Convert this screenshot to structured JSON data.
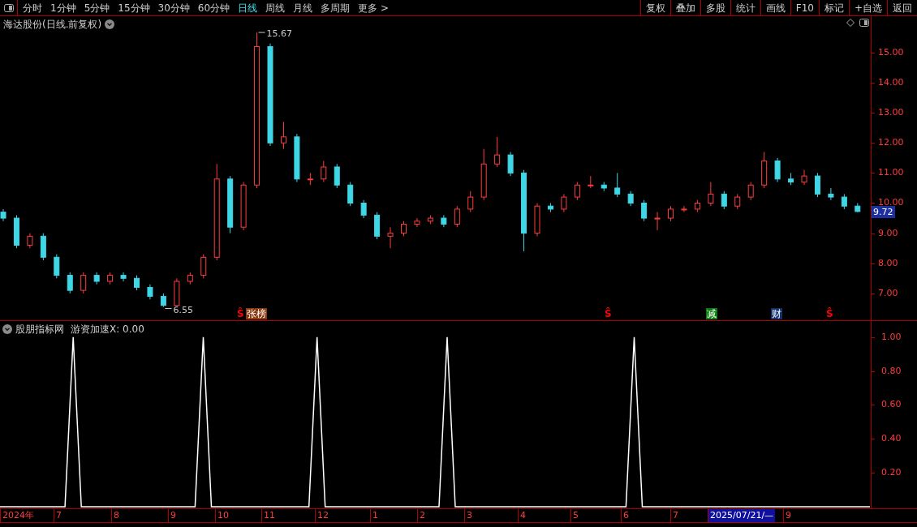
{
  "toolbar": {
    "periods": [
      {
        "label": "分时",
        "selected": false
      },
      {
        "label": "1分钟",
        "selected": false
      },
      {
        "label": "5分钟",
        "selected": false
      },
      {
        "label": "15分钟",
        "selected": false
      },
      {
        "label": "30分钟",
        "selected": false
      },
      {
        "label": "60分钟",
        "selected": false
      },
      {
        "label": "日线",
        "selected": true
      },
      {
        "label": "周线",
        "selected": false
      },
      {
        "label": "月线",
        "selected": false
      },
      {
        "label": "多周期",
        "selected": false
      },
      {
        "label": "更多 >",
        "selected": false
      }
    ],
    "actions": [
      "复权",
      "叠加",
      "多股",
      "统计",
      "画线",
      "F10",
      "标记",
      "+自选",
      "返回"
    ]
  },
  "main_chart": {
    "title": "海达股份(日线.前复权)",
    "current_price": "9.72",
    "high_label": "15.67",
    "low_label": "6.55",
    "chart_data": {
      "type": "candlestick",
      "ylim": [
        6.08,
        16.21
      ],
      "yticks": [
        {
          "value": 7,
          "label": "7.00"
        },
        {
          "value": 8,
          "label": "8.00"
        },
        {
          "value": 9,
          "label": "9.00"
        },
        {
          "value": 10,
          "label": "10.00"
        },
        {
          "value": 11,
          "label": "11.00"
        },
        {
          "value": 12,
          "label": "12.00"
        },
        {
          "value": 13,
          "label": "13.00"
        },
        {
          "value": 14,
          "label": "14.00"
        },
        {
          "value": 15,
          "label": "15.00"
        }
      ],
      "ohlc": [
        [
          9.7,
          9.8,
          9.4,
          9.5
        ],
        [
          9.5,
          9.6,
          8.5,
          8.6
        ],
        [
          8.6,
          9.0,
          8.5,
          8.9
        ],
        [
          8.9,
          9.0,
          8.1,
          8.2
        ],
        [
          8.2,
          8.3,
          7.5,
          7.6
        ],
        [
          7.6,
          7.7,
          7.0,
          7.1
        ],
        [
          7.1,
          7.7,
          7.0,
          7.6
        ],
        [
          7.6,
          7.7,
          7.3,
          7.4
        ],
        [
          7.4,
          7.7,
          7.3,
          7.6
        ],
        [
          7.6,
          7.7,
          7.4,
          7.5
        ],
        [
          7.5,
          7.6,
          7.1,
          7.2
        ],
        [
          7.2,
          7.3,
          6.8,
          6.9
        ],
        [
          6.9,
          7.0,
          6.55,
          6.6
        ],
        [
          6.6,
          7.5,
          6.6,
          7.4
        ],
        [
          7.4,
          7.7,
          7.3,
          7.6
        ],
        [
          7.6,
          8.3,
          7.5,
          8.2
        ],
        [
          8.2,
          11.3,
          8.1,
          10.8
        ],
        [
          10.8,
          10.9,
          9.0,
          9.2
        ],
        [
          9.2,
          10.7,
          9.1,
          10.6
        ],
        [
          10.6,
          15.67,
          10.5,
          15.2
        ],
        [
          15.2,
          15.3,
          11.9,
          12.0
        ],
        [
          12.0,
          12.7,
          11.8,
          12.2
        ],
        [
          12.2,
          12.3,
          10.7,
          10.8
        ],
        [
          10.8,
          11.0,
          10.6,
          10.8
        ],
        [
          10.8,
          11.4,
          10.7,
          11.2
        ],
        [
          11.2,
          11.3,
          10.5,
          10.6
        ],
        [
          10.6,
          10.7,
          9.9,
          10.0
        ],
        [
          10.0,
          10.1,
          9.5,
          9.6
        ],
        [
          9.6,
          9.7,
          8.8,
          8.9
        ],
        [
          8.9,
          9.2,
          8.5,
          9.0
        ],
        [
          9.0,
          9.4,
          8.9,
          9.3
        ],
        [
          9.3,
          9.5,
          9.2,
          9.4
        ],
        [
          9.4,
          9.6,
          9.3,
          9.5
        ],
        [
          9.5,
          9.6,
          9.2,
          9.3
        ],
        [
          9.3,
          9.9,
          9.2,
          9.8
        ],
        [
          9.8,
          10.4,
          9.7,
          10.2
        ],
        [
          10.2,
          11.8,
          10.1,
          11.3
        ],
        [
          11.3,
          12.2,
          11.2,
          11.6
        ],
        [
          11.6,
          11.7,
          10.9,
          11.0
        ],
        [
          11.0,
          11.1,
          8.4,
          9.0
        ],
        [
          9.0,
          10.0,
          8.9,
          9.9
        ],
        [
          9.9,
          10.0,
          9.7,
          9.8
        ],
        [
          9.8,
          10.3,
          9.7,
          10.2
        ],
        [
          10.2,
          10.7,
          10.1,
          10.6
        ],
        [
          10.6,
          10.9,
          10.5,
          10.6
        ],
        [
          10.6,
          10.7,
          10.4,
          10.5
        ],
        [
          10.5,
          11.0,
          10.2,
          10.3
        ],
        [
          10.3,
          10.4,
          9.9,
          10.0
        ],
        [
          10.0,
          10.1,
          9.4,
          9.5
        ],
        [
          9.5,
          9.7,
          9.1,
          9.5
        ],
        [
          9.5,
          9.9,
          9.4,
          9.8
        ],
        [
          9.8,
          9.9,
          9.7,
          9.8
        ],
        [
          9.8,
          10.1,
          9.7,
          10.0
        ],
        [
          10.0,
          10.7,
          9.9,
          10.3
        ],
        [
          10.3,
          10.4,
          9.8,
          9.9
        ],
        [
          9.9,
          10.3,
          9.8,
          10.2
        ],
        [
          10.2,
          10.7,
          10.1,
          10.6
        ],
        [
          10.6,
          11.7,
          10.5,
          11.4
        ],
        [
          11.4,
          11.5,
          10.7,
          10.8
        ],
        [
          10.8,
          11.0,
          10.6,
          10.7
        ],
        [
          10.7,
          11.1,
          10.6,
          10.9
        ],
        [
          10.9,
          11.0,
          10.2,
          10.3
        ],
        [
          10.3,
          10.5,
          10.1,
          10.2
        ],
        [
          10.2,
          10.3,
          9.8,
          9.9
        ],
        [
          9.9,
          10.0,
          9.7,
          9.72
        ]
      ]
    },
    "markers": [
      {
        "kind": "symbol",
        "text": "Ŝ",
        "color": "#ff0000"
      },
      {
        "kind": "tag",
        "text": "张榜",
        "color": "#8b3a10"
      },
      {
        "kind": "symbol",
        "text": "Ŝ",
        "color": "#ff0000"
      },
      {
        "kind": "tag",
        "text": "减",
        "color": "#0a7a0a"
      },
      {
        "kind": "tag",
        "text": "财",
        "color": "#12306e"
      },
      {
        "kind": "symbol",
        "text": "Ŝ",
        "color": "#ff0000"
      }
    ]
  },
  "indicator": {
    "source": "股朋指标网",
    "reading": "游资加速X: 0.00",
    "chart_data": {
      "type": "line",
      "ylim": [
        -0.01,
        1.095
      ],
      "yticks": [
        {
          "value": 0.2,
          "label": "0.20"
        },
        {
          "value": 0.4,
          "label": "0.40"
        },
        {
          "value": 0.6,
          "label": "0.60"
        },
        {
          "value": 0.8,
          "label": "0.80"
        },
        {
          "value": 1,
          "label": "1.00"
        }
      ],
      "series": [
        {
          "color": "#ffffff",
          "values": [
            0,
            0,
            0,
            0,
            0,
            0,
            0,
            0,
            0,
            1,
            0,
            0,
            0,
            0,
            0,
            0,
            0,
            0,
            0,
            0,
            0,
            0,
            0,
            0,
            0,
            1,
            0,
            0,
            0,
            0,
            0,
            0,
            0,
            0,
            0,
            0,
            0,
            0,
            0,
            1,
            0,
            0,
            0,
            0,
            0,
            0,
            0,
            0,
            0,
            0,
            0,
            0,
            0,
            0,
            0,
            1,
            0,
            0,
            0,
            0,
            0,
            0,
            0,
            0,
            0,
            0,
            0,
            0,
            0,
            0,
            0,
            0,
            0,
            0,
            0,
            0,
            0,
            0,
            1,
            0,
            0,
            0,
            0,
            0,
            0,
            0,
            0,
            0,
            0,
            0,
            0,
            0,
            0,
            0,
            0,
            0,
            0,
            0,
            0,
            0,
            0,
            0,
            0,
            0,
            0,
            0,
            0,
            0
          ]
        }
      ]
    }
  },
  "date_axis": [
    {
      "label": "2024年",
      "selected": false
    },
    {
      "label": "7",
      "selected": false
    },
    {
      "label": "8",
      "selected": false
    },
    {
      "label": "9",
      "selected": false
    },
    {
      "label": "10",
      "selected": false
    },
    {
      "label": "11",
      "selected": false
    },
    {
      "label": "12",
      "selected": false
    },
    {
      "label": "1",
      "selected": false
    },
    {
      "label": "2",
      "selected": false
    },
    {
      "label": "3",
      "selected": false
    },
    {
      "label": "4",
      "selected": false
    },
    {
      "label": "5",
      "selected": false
    },
    {
      "label": "6",
      "selected": false
    },
    {
      "label": "7",
      "selected": false
    },
    {
      "label": "2025/07/21/—",
      "selected": true
    },
    {
      "label": "9",
      "selected": false
    }
  ]
}
